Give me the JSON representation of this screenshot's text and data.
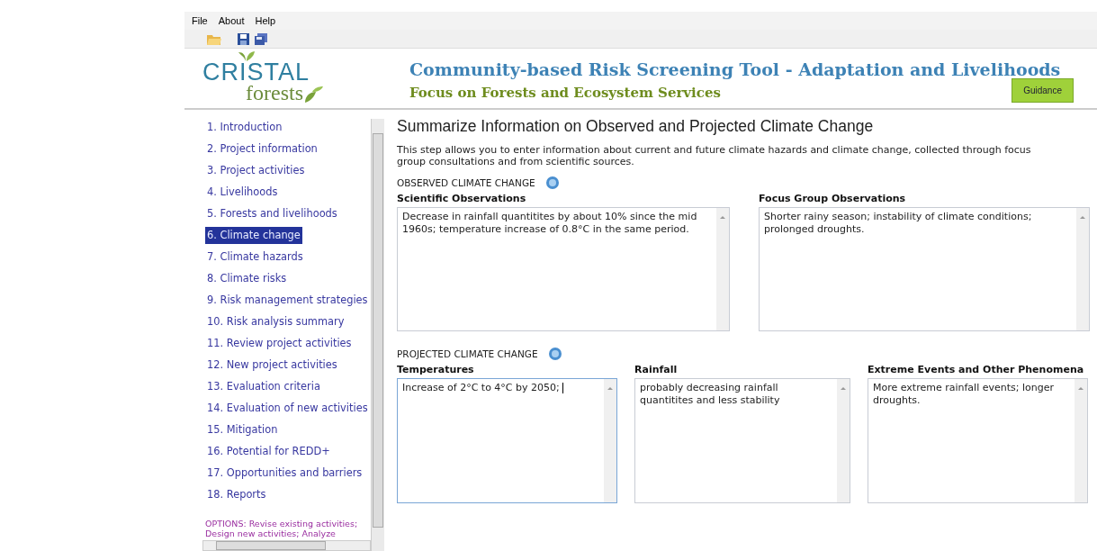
{
  "menu": [
    "File",
    "About",
    "Help"
  ],
  "logo": {
    "line1": "CRISTAL",
    "line2": "forests"
  },
  "header": {
    "title": "Community-based Risk Screening Tool - Adaptation and Livelihoods",
    "subtitle": "Focus on Forests and Ecosystem Services",
    "button": "Guidance"
  },
  "sidebar": {
    "items": [
      {
        "label": "1. Introduction",
        "selected": false
      },
      {
        "label": "2. Project information",
        "selected": false
      },
      {
        "label": "3. Project activities",
        "selected": false
      },
      {
        "label": "4. Livelihoods",
        "selected": false
      },
      {
        "label": "5. Forests and livelihoods",
        "selected": false
      },
      {
        "label": "6. Climate change",
        "selected": true
      },
      {
        "label": "7. Climate hazards",
        "selected": false
      },
      {
        "label": "8. Climate risks",
        "selected": false
      },
      {
        "label": "9. Risk management strategies",
        "selected": false
      },
      {
        "label": "10. Risk analysis summary",
        "selected": false
      },
      {
        "label": "11. Review project activities",
        "selected": false
      },
      {
        "label": "12. New project activities",
        "selected": false
      },
      {
        "label": "13. Evaluation criteria",
        "selected": false
      },
      {
        "label": "14. Evaluation of new activities",
        "selected": false
      },
      {
        "label": "15. Mitigation",
        "selected": false
      },
      {
        "label": "16. Potential for REDD+",
        "selected": false
      },
      {
        "label": "17. Opportunities and barriers",
        "selected": false
      },
      {
        "label": "18. Reports",
        "selected": false
      }
    ],
    "options": "OPTIONS: Revise existing activities; Design new activities; Analyze"
  },
  "page": {
    "title": "Summarize Information on Observed and Projected Climate Change",
    "intro": "This step allows you to enter information about current and future climate hazards and climate change, collected through focus group consultations and from scientific sources.",
    "sections": [
      {
        "heading": "OBSERVED CLIMATE CHANGE",
        "fields": [
          {
            "label": "Scientific Observations",
            "value": "Decrease in rainfall quantitites by about 10% since the mid 1960s; temperature increase of 0.8°C in the same period.",
            "focused": false
          },
          {
            "label": "Focus Group Observations",
            "value": "Shorter rainy season; instability of climate conditions; prolonged droughts.",
            "focused": false
          }
        ]
      },
      {
        "heading": "PROJECTED CLIMATE CHANGE",
        "fields": [
          {
            "label": "Temperatures",
            "value": "Increase of 2°C to 4°C by 2050;",
            "focused": true
          },
          {
            "label": "Rainfall",
            "value": "probably decreasing rainfall quantitites and less stability",
            "focused": false
          },
          {
            "label": "Extreme Events and Other Phenomena",
            "value": "More extreme rainfall events; longer droughts.",
            "focused": false
          }
        ]
      }
    ]
  }
}
